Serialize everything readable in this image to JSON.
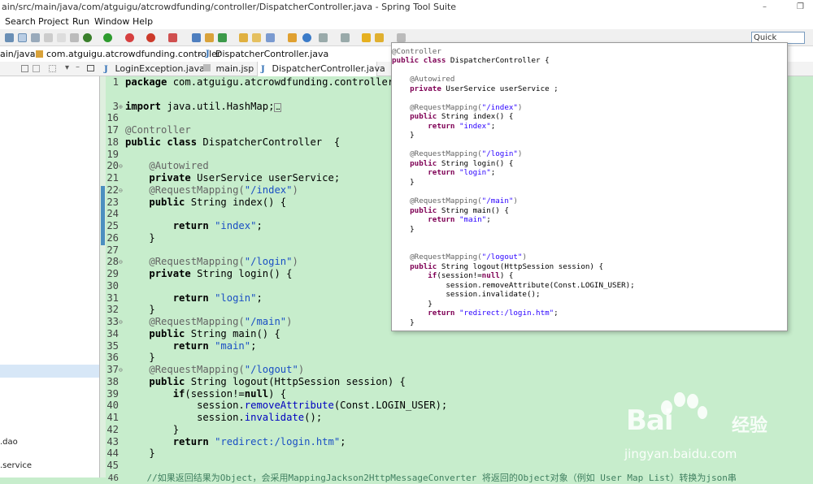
{
  "window": {
    "title": "ain/src/main/java/com/atguigu/atcrowdfunding/controller/DispatcherController.java - Spring Tool Suite",
    "minimize": "–",
    "restore": "❐"
  },
  "menu": [
    "Search",
    "Project",
    "Run",
    "Window",
    "Help"
  ],
  "toolbar": {
    "quick_access": "Quick Access"
  },
  "breadcrumb": {
    "root": "ain/java",
    "package": "com.atguigu.atcrowdfunding.controller",
    "file": "DispatcherController.java"
  },
  "tabs": [
    "LoginException.java",
    "main.jsp",
    "DispatcherController.java"
  ],
  "left_pane": {
    "item_dao": ".dao",
    "item_service": ".service"
  },
  "code": {
    "l1": "1",
    "t1": "package com.atguigu.atcrowdfunding.controller;",
    "l3": "3",
    "t3": "import java.util.HashMap;",
    "l16": "16",
    "t16": "",
    "l17": "17",
    "t17": "@Controller",
    "l18": "18",
    "t18a": "public class ",
    "t18b": "DispatcherController  {",
    "l19": "19",
    "l20": "20",
    "t20": "@Autowired",
    "l21": "21",
    "t21a": "private ",
    "t21b": "UserService userService;",
    "l22": "22",
    "t22a": "@RequestMapping(",
    "t22b": "\"/index\"",
    "t22c": ")",
    "l23": "23",
    "t23a": "public ",
    "t23b": "String index() {",
    "l24": "24",
    "l25": "25",
    "t25a": "return ",
    "t25b": "\"index\"",
    "t25c": ";",
    "l26": "26",
    "t26": "}",
    "l27": "27",
    "l28": "28",
    "t28a": "@RequestMapping(",
    "t28b": "\"/login\"",
    "t28c": ")",
    "l29": "29",
    "t29a": "private ",
    "t29b": "String login() {",
    "l30": "30",
    "l31": "31",
    "t31a": "return ",
    "t31b": "\"login\"",
    "t31c": ";",
    "l32": "32",
    "t32": "}",
    "l33": "33",
    "t33a": "@RequestMapping(",
    "t33b": "\"/main\"",
    "t33c": ")",
    "l34": "34",
    "t34a": "public ",
    "t34b": "String main() {",
    "l35": "35",
    "t35a": "return ",
    "t35b": "\"main\"",
    "t35c": ";",
    "l36": "36",
    "t36": "}",
    "l37": "37",
    "t37a": "@RequestMapping(",
    "t37b": "\"/logout\"",
    "t37c": ")",
    "l38": "38",
    "t38a": "public ",
    "t38b": "String logout(HttpSession session) {",
    "l39": "39",
    "t39a": "if",
    "t39b": "(session!=",
    "t39c": "null",
    "t39d": ") {",
    "l40": "40",
    "t40a": "session.",
    "t40b": "removeAttribute",
    "t40c": "(Const.LOGIN_USER);",
    "l41": "41",
    "t41a": "session.",
    "t41b": "invalidate",
    "t41c": "();",
    "l42": "42",
    "t42": "}",
    "l43": "43",
    "t43a": "return ",
    "t43b": "\"redirect:/login.htm\"",
    "t43c": ";",
    "l44": "44",
    "t44": "}",
    "l45": "45",
    "l46": "46",
    "t46": "//如果返回结果为Object，会采用MappingJackson2HttpMessageConverter 将返回的Object对象（例如 User Map List）转换为json串"
  },
  "popup": {
    "p1": "@Controller",
    "p2a": "public class ",
    "p2b": "DispatcherController {",
    "p3": "@Autowired",
    "p4a": "private ",
    "p4b": "UserService userService ;",
    "p5a": "@RequestMapping(",
    "p5b": "\"/index\"",
    "p5c": ")",
    "p6a": "public ",
    "p6b": "String index() {",
    "p7a": "return ",
    "p7b": "\"index\"",
    "p7c": ";",
    "p8": "}",
    "p9a": "@RequestMapping(",
    "p9b": "\"/login\"",
    "p9c": ")",
    "p10a": "public ",
    "p10b": "String login() {",
    "p11a": "return ",
    "p11b": "\"login\"",
    "p11c": ";",
    "p12": "}",
    "p13a": "@RequestMapping(",
    "p13b": "\"/main\"",
    "p13c": ")",
    "p14a": "public ",
    "p14b": "String main() {",
    "p15a": "return ",
    "p15b": "\"main\"",
    "p15c": ";",
    "p16": "}",
    "p17a": "@RequestMapping(",
    "p17b": "\"/logout\"",
    "p17c": ")",
    "p18a": "public ",
    "p18b": "String logout(HttpSession session) {",
    "p19a": "if",
    "p19b": "(session!=",
    "p19c": "null",
    "p19d": ") {",
    "p20": "session.removeAttribute(Const.LOGIN_USER);",
    "p21": "session.invalidate();",
    "p22": "}",
    "p23a": "return ",
    "p23b": "\"redirect:/login.htm\"",
    "p23c": ";",
    "p24": "}"
  },
  "watermark": {
    "brand": "Bai",
    "brand2": "经验",
    "url": "jingyan.baidu.com"
  },
  "colors": {
    "editor_bg": "#c7edcc",
    "keyword": "#000000",
    "string": "#1a4fc4",
    "annotation": "#646464"
  }
}
